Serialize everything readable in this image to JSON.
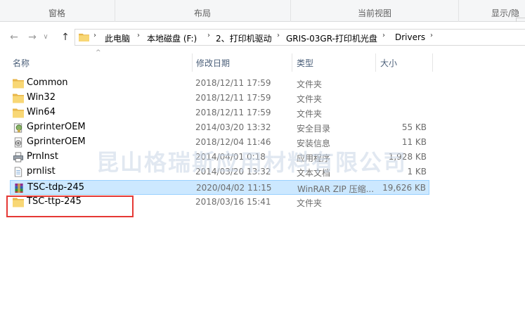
{
  "ribbon": {
    "groups": [
      "窗格",
      "布局",
      "当前视图",
      "显示/隐"
    ]
  },
  "nav": {
    "back": "←",
    "forward": "→",
    "recent": "∨",
    "up": "↑"
  },
  "breadcrumb": [
    "此电脑",
    "本地磁盘 (F:)",
    "2、打印机驱动",
    "GRIS-03GR-打印机光盘",
    "Drivers"
  ],
  "columns": {
    "name": "名称",
    "date": "修改日期",
    "type": "类型",
    "size": "大小"
  },
  "files": [
    {
      "name": "Common",
      "date": "2018/12/11 17:59",
      "type": "文件夹",
      "size": "",
      "icon": "folder-icon"
    },
    {
      "name": "Win32",
      "date": "2018/12/11 17:59",
      "type": "文件夹",
      "size": "",
      "icon": "folder-icon"
    },
    {
      "name": "Win64",
      "date": "2018/12/11 17:59",
      "type": "文件夹",
      "size": "",
      "icon": "folder-icon"
    },
    {
      "name": "GprinterOEM",
      "date": "2014/03/20 13:32",
      "type": "安全目录",
      "size": "55 KB",
      "icon": "security-catalog-icon"
    },
    {
      "name": "GprinterOEM",
      "date": "2018/12/04 11:46",
      "type": "安装信息",
      "size": "11 KB",
      "icon": "setup-info-icon"
    },
    {
      "name": "PrnInst",
      "date": "2014/04/01 0:18",
      "type": "应用程序",
      "size": "1,928 KB",
      "icon": "printer-app-icon"
    },
    {
      "name": "prnlist",
      "date": "2014/03/20 13:32",
      "type": "文本文档",
      "size": "1 KB",
      "icon": "text-file-icon"
    },
    {
      "name": "TSC-tdp-245",
      "date": "2020/04/02 11:15",
      "type": "WinRAR ZIP 压缩...",
      "size": "19,626 KB",
      "icon": "winrar-archive-icon"
    },
    {
      "name": "TSC-ttp-245",
      "date": "2018/03/16 15:41",
      "type": "文件夹",
      "size": "",
      "icon": "folder-icon"
    }
  ],
  "watermark": "昆山格瑞斯应用材料有限公司",
  "colors": {
    "folder": "#f8d775",
    "selection": "#cce8ff",
    "highlight": "#e53935",
    "header_text": "#4c607a"
  }
}
